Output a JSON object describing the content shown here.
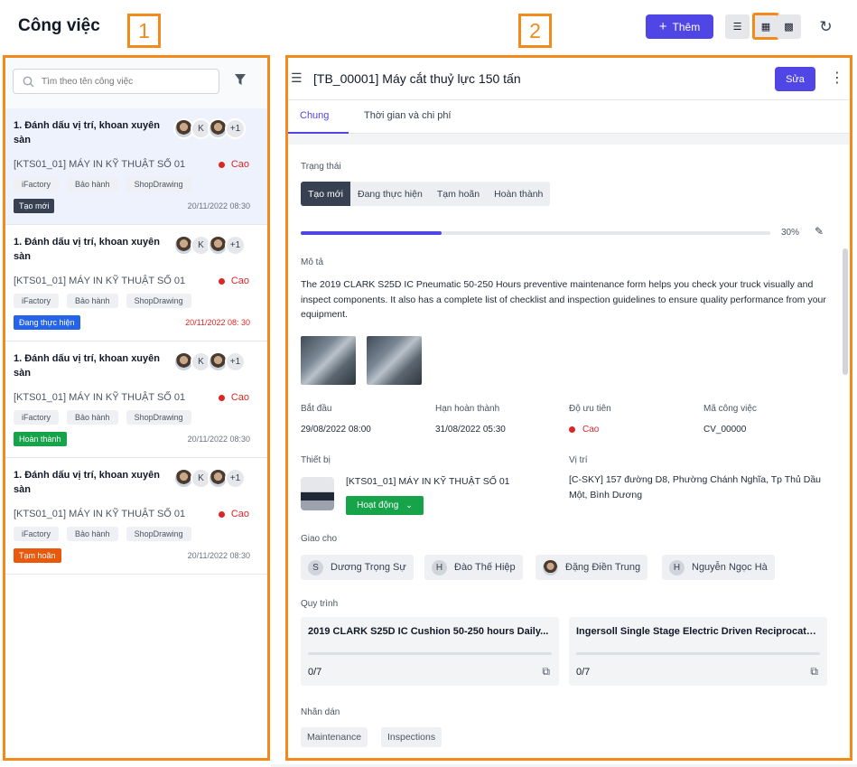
{
  "header": {
    "title": "Công việc",
    "add_label": "Thêm"
  },
  "callouts": [
    "1",
    "2"
  ],
  "search": {
    "placeholder": "Tìm theo tên công việc"
  },
  "tasks": [
    {
      "title": "1. Đánh dấu vị trí, khoan xuyên sàn",
      "extra": "+1",
      "avatar_letter": "K",
      "machine": "[KTS01_01] MÁY IN KỸ THUẬT SỐ 01",
      "priority": "Cao",
      "tags": [
        "iFactory",
        "Bảo hành",
        "ShopDrawing"
      ],
      "status": "Tạo mới",
      "status_color": "#374151",
      "date": "20/11/2022 08:30",
      "date_overdue": false
    },
    {
      "title": "1. Đánh dấu vị trí, khoan xuyên sàn",
      "extra": "+1",
      "avatar_letter": "K",
      "machine": "[KTS01_01] MÁY IN KỸ THUẬT SỐ 01",
      "priority": "Cao",
      "tags": [
        "iFactory",
        "Bảo hành",
        "ShopDrawing"
      ],
      "status": "Đang thực hiện",
      "status_color": "#2563eb",
      "date": "20/11/2022 08: 30",
      "date_overdue": true
    },
    {
      "title": "1. Đánh dấu vị trí, khoan xuyên sàn",
      "extra": "+1",
      "avatar_letter": "K",
      "machine": "[KTS01_01] MÁY IN KỸ THUẬT SỐ 01",
      "priority": "Cao",
      "tags": [
        "iFactory",
        "Bảo hành",
        "ShopDrawing"
      ],
      "status": "Hoàn thành",
      "status_color": "#16a34a",
      "date": "20/11/2022 08:30",
      "date_overdue": false
    },
    {
      "title": "1. Đánh dấu vị trí, khoan xuyên sàn",
      "extra": "+1",
      "avatar_letter": "K",
      "machine": "[KTS01_01] MÁY IN KỸ THUẬT SỐ 01",
      "priority": "Cao",
      "tags": [
        "iFactory",
        "Bảo hành",
        "ShopDrawing"
      ],
      "status": "Tạm hoãn",
      "status_color": "#ea580c",
      "date": "20/11/2022 08:30",
      "date_overdue": false
    }
  ],
  "detail": {
    "title": "[TB_00001] Máy cắt thuỷ lực 150 tấn",
    "edit_label": "Sửa",
    "tabs": [
      "Chung",
      "Thời gian và chi phí"
    ],
    "status_label": "Trạng thái",
    "statuses": [
      "Tạo mới",
      "Đang thực hiện",
      "Tạm hoãn",
      "Hoàn thành"
    ],
    "progress_percent": 30,
    "progress_text": "30%",
    "desc_label": "Mô tả",
    "description": "The 2019 CLARK S25D IC Pneumatic 50-250 Hours preventive maintenance form helps you check your truck visually and inspect components. It also has a complete list of checklist and inspection guidelines to ensure quality performance from your equipment.",
    "start_label": "Bắt đầu",
    "start_value": "29/08/2022 08:00",
    "deadline_label": "Hạn hoàn thành",
    "deadline_value": "31/08/2022 05:30",
    "priority_label": "Độ ưu tiên",
    "priority_value": "Cao",
    "code_label": "Mã công việc",
    "code_value": "CV_00000",
    "device_label": "Thiết bị",
    "device_value": "[KTS01_01] MÁY IN KỸ THUẬT SỐ 01",
    "device_status": "Hoạt động",
    "location_label": "Vị trí",
    "location_value": "[C-SKY] 157 đường D8, Phường Chánh Nghĩa, Tp Thủ Dầu Một, Bình Dương",
    "assign_label": "Giao cho",
    "assignees": [
      {
        "initial": "S",
        "name": "Dương Trọng Sự"
      },
      {
        "initial": "H",
        "name": "Đào Thế Hiệp"
      },
      {
        "initial": "",
        "name": "Đặng Điền Trung"
      },
      {
        "initial": "H",
        "name": "Nguyễn Ngọc Hà"
      }
    ],
    "process_label": "Quy trình",
    "processes": [
      {
        "title": "2019 CLARK S25D IC Cushion 50-250 hours Daily...",
        "count": "0/7"
      },
      {
        "title": "Ingersoll Single Stage Electric Driven Reciprocating...",
        "count": "0/7"
      }
    ],
    "labels_label": "Nhãn dán",
    "labels": [
      "Maintenance",
      "Inspections"
    ]
  }
}
